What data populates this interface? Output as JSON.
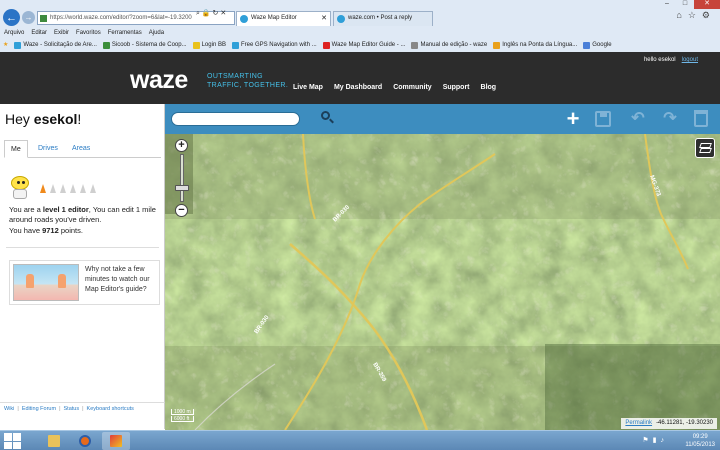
{
  "browser": {
    "address": "https://world.waze.com/editor/?zoom=6&lat=-19.3200",
    "tabs": [
      {
        "label": "Waze Map Editor"
      },
      {
        "label": "waze.com • Post a reply"
      }
    ],
    "menu": [
      "Arquivo",
      "Editar",
      "Exibir",
      "Favoritos",
      "Ferramentas",
      "Ajuda"
    ],
    "favorites": [
      {
        "label": "Waze - Solicitação de Are...",
        "color": "#2f9fd8"
      },
      {
        "label": "Sicoob - Sistema de Coop...",
        "color": "#3b8e3b"
      },
      {
        "label": "Login BB",
        "color": "#e9c21c"
      },
      {
        "label": "Free GPS Navigation with ...",
        "color": "#2f9fd8"
      },
      {
        "label": "Waze Map Editor Guide - ...",
        "color": "#d22"
      },
      {
        "label": "Manual de edição - waze",
        "color": "#888"
      },
      {
        "label": "Inglês na Ponta da Língua...",
        "color": "#e9a11c"
      },
      {
        "label": "Google",
        "color": "#4a7fd8"
      }
    ]
  },
  "header": {
    "logo": "waze",
    "tagline_1": "OUTSMARTING",
    "tagline_2": "TRAFFIC, TOGETHER.",
    "nav": [
      "Live Map",
      "My Dashboard",
      "Community",
      "Support",
      "Blog"
    ],
    "greeting": "hello esekol",
    "logout": "logout"
  },
  "sidebar": {
    "hey": "Hey ",
    "username": "esekol",
    "exclaim": "!",
    "tabs": [
      "Me",
      "Drives",
      "Areas"
    ],
    "level_pre": "You are a ",
    "level_bold": "level 1 editor",
    "level_post": ", You can edit 1 mile around roads you've driven.",
    "points_pre": "You have ",
    "points_value": "9712",
    "points_post": " points.",
    "guide_text": "Why not take a few minutes to watch our Map Editor's guide?",
    "level": 1,
    "level_max": 6,
    "footer_links": [
      "Wiki",
      "Editing Forum",
      "Status",
      "Keyboard shortcuts"
    ]
  },
  "map": {
    "road_labels": [
      "BR-030",
      "BR-030",
      "BR-359",
      "MG-373"
    ],
    "scale_metric": "1000 m",
    "scale_imperial": "6000 ft",
    "permalink": "Permalink",
    "coords": "-46.11281, -19.30230"
  },
  "taskbar": {
    "time": "09:29",
    "date": "11/05/2013"
  },
  "colors": {
    "header_bg": "#2c2c2c",
    "toolbar_bg": "#3d8dbf",
    "tagline": "#45c0e9",
    "link": "#2a7cc4"
  }
}
